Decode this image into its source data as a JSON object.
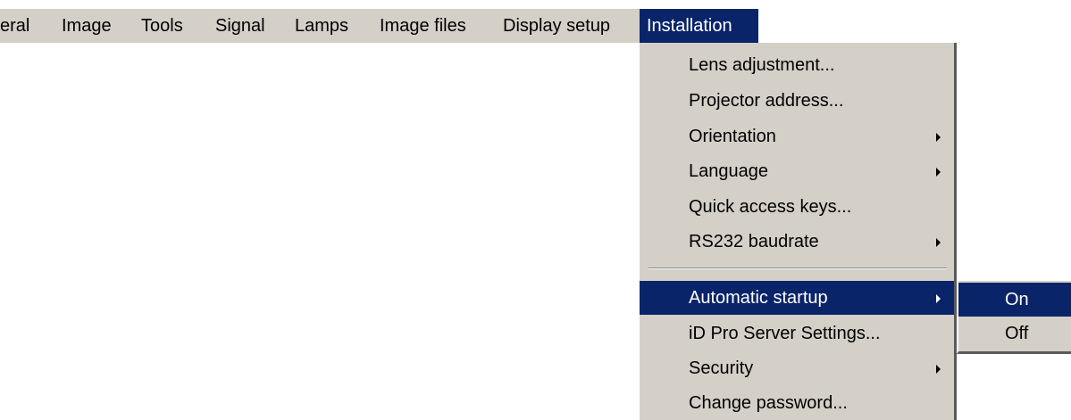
{
  "menubar": {
    "items": [
      {
        "label": "eral"
      },
      {
        "label": "Image"
      },
      {
        "label": "Tools"
      },
      {
        "label": "Signal"
      },
      {
        "label": "Lamps"
      },
      {
        "label": "Image files"
      },
      {
        "label": "Display setup"
      },
      {
        "label": "Installation"
      }
    ],
    "active_item": "Installation"
  },
  "installation_menu": {
    "items": [
      {
        "label": "Lens adjustment...",
        "has_submenu": false
      },
      {
        "label": "Projector address...",
        "has_submenu": false
      },
      {
        "label": "Orientation",
        "has_submenu": true
      },
      {
        "label": "Language",
        "has_submenu": true
      },
      {
        "label": "Quick access keys...",
        "has_submenu": false
      },
      {
        "label": "RS232 baudrate",
        "has_submenu": true
      },
      {
        "label": "Automatic startup",
        "has_submenu": true
      },
      {
        "label": "iD Pro Server Settings...",
        "has_submenu": false
      },
      {
        "label": "Security",
        "has_submenu": true
      },
      {
        "label": "Change password...",
        "has_submenu": false
      }
    ],
    "selected_item": "Automatic startup"
  },
  "automatic_startup_submenu": {
    "items": [
      {
        "label": "On"
      },
      {
        "label": "Off"
      }
    ],
    "selected_item": "On"
  },
  "colors": {
    "menu_background": "#d4d0c8",
    "highlight": "#0a246a",
    "highlight_text": "#ffffff"
  }
}
